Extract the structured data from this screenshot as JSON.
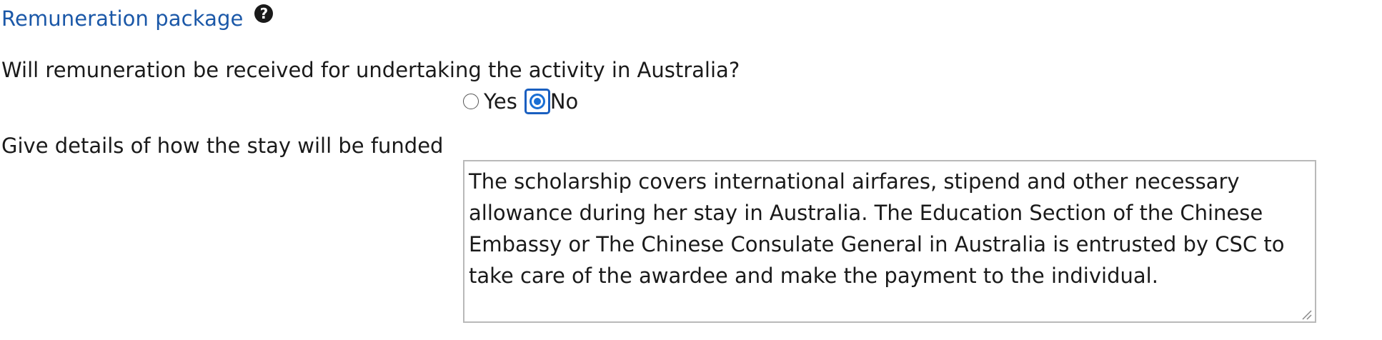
{
  "section": {
    "title": "Remuneration package",
    "help_icon": "question-circle-icon",
    "help_glyph": "?"
  },
  "remuneration_question": {
    "label": "Will remuneration be received for undertaking the activity in Australia?",
    "options": [
      {
        "label": "Yes",
        "selected": false
      },
      {
        "label": "No",
        "selected": true
      }
    ]
  },
  "funding": {
    "label": "Give details of how the stay will be funded",
    "value": "The scholarship covers international airfares, stipend and other necessary allowance during her stay in Australia. The Education Section of the Chinese Embassy or The Chinese Consulate General in Australia is entrusted by CSC to take care of the awardee and make the payment to the individual."
  },
  "colors": {
    "title": "#1b58a8",
    "radio_accent": "#1a6fd4",
    "focus_ring": "#1a5fc0",
    "textarea_border": "#b9b9b9"
  }
}
